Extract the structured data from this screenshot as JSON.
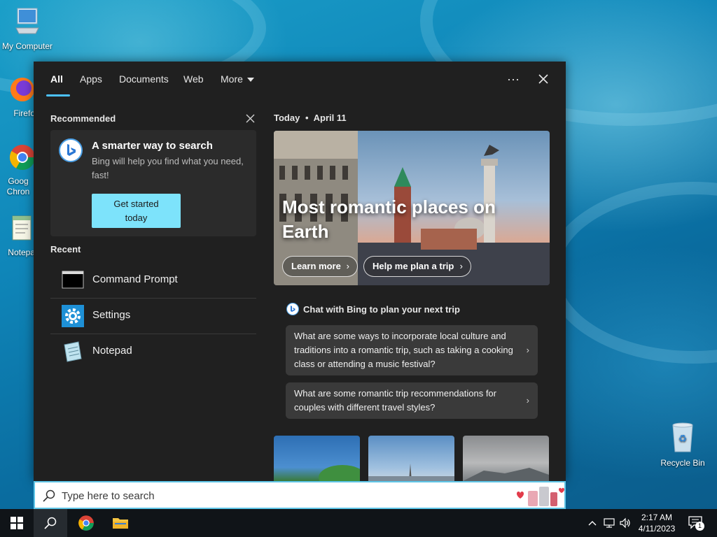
{
  "desktop": {
    "icons": [
      {
        "label": "My Computer"
      },
      {
        "label": "Firefo"
      },
      {
        "label": "Goog Chron"
      },
      {
        "label": "Notepa"
      },
      {
        "label": "Recycle Bin"
      }
    ]
  },
  "search_panel": {
    "tabs": [
      {
        "label": "All",
        "active": true
      },
      {
        "label": "Apps"
      },
      {
        "label": "Documents"
      },
      {
        "label": "Web"
      },
      {
        "label": "More"
      }
    ],
    "more_options_icon": "ellipsis-icon",
    "close_icon": "close-icon",
    "recommended": {
      "title": "Recommended",
      "card": {
        "title": "A smarter way to search",
        "description": "Bing will help you find what you need, fast!",
        "button_line1": "Get started",
        "button_line2": "today"
      }
    },
    "recent": {
      "title": "Recent",
      "items": [
        {
          "label": "Command Prompt",
          "icon": "command-prompt-icon"
        },
        {
          "label": "Settings",
          "icon": "gear-icon"
        },
        {
          "label": "Notepad",
          "icon": "notepad-icon"
        }
      ]
    },
    "today": {
      "label": "Today",
      "separator": "•",
      "date": "April 11",
      "hero_title": "Most romantic places on Earth",
      "learn_more": "Learn more",
      "plan_trip": "Help me plan a trip"
    },
    "chat": {
      "heading": "Chat with Bing to plan your next trip",
      "suggestions": [
        "What are some ways to incorporate local culture and traditions into a romantic trip, such as taking a cooking class or attending a music festival?",
        "What are some romantic trip recommendations for couples with different travel styles?"
      ]
    }
  },
  "searchbar": {
    "placeholder": "Type here to search"
  },
  "taskbar": {
    "time": "2:17 AM",
    "date": "4/11/2023",
    "notification_count": "1"
  },
  "colors": {
    "accent": "#4cc2ff",
    "button": "#7de3fb",
    "panel_bg": "#202020"
  }
}
